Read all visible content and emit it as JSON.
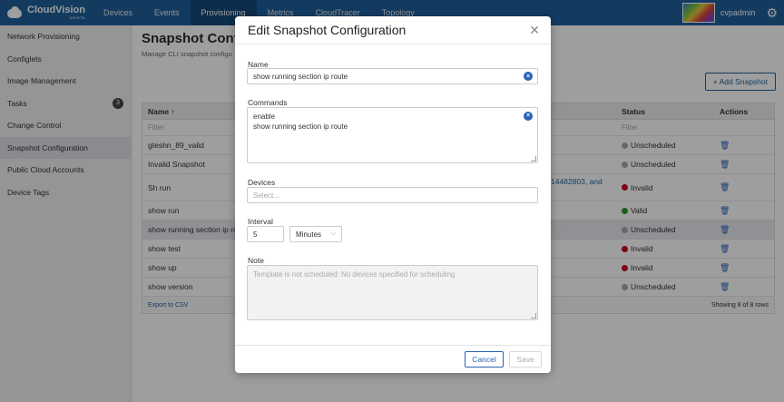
{
  "brand": {
    "name": "CloudVision",
    "sub": "ARISTA"
  },
  "nav": {
    "tabs": [
      "Devices",
      "Events",
      "Provisioning",
      "Metrics",
      "CloudTracer",
      "Topology"
    ],
    "active": "Provisioning"
  },
  "user": {
    "name": "cvpadmin"
  },
  "sidebar": {
    "items": [
      {
        "label": "Network Provisioning"
      },
      {
        "label": "Configlets"
      },
      {
        "label": "Image Management"
      },
      {
        "label": "Tasks",
        "badge": "3"
      },
      {
        "label": "Change Control"
      },
      {
        "label": "Snapshot Configuration",
        "active": true
      },
      {
        "label": "Public Cloud Accounts"
      },
      {
        "label": "Device Tags"
      }
    ]
  },
  "page": {
    "title": "Snapshot Configu",
    "subtitle": "Manage CLI snapshot configu",
    "add_button": "+ Add Snapshot"
  },
  "table": {
    "headers": {
      "name": "Name ↑",
      "status": "Status",
      "actions": "Actions"
    },
    "filter_placeholder": {
      "name": "Filter",
      "status": "Filter"
    },
    "rows": [
      {
        "name": "gteshn_89_valid",
        "status": "Unscheduled",
        "status_color": "#a8a8a8"
      },
      {
        "name": "Invalid Snapshot",
        "status": "Unscheduled",
        "status_color": "#a8a8a8"
      },
      {
        "name": "Sh run",
        "mid": "14482803, and",
        "status": "Invalid",
        "status_color": "#d0021b"
      },
      {
        "name": "show run",
        "status": "Valid",
        "status_color": "#2a9d2a"
      },
      {
        "name": "show running section ip ro",
        "status": "Unscheduled",
        "status_color": "#a8a8a8"
      },
      {
        "name": "show test",
        "status": "Invalid",
        "status_color": "#d0021b"
      },
      {
        "name": "show up",
        "status": "Invalid",
        "status_color": "#d0021b"
      },
      {
        "name": "show version",
        "status": "Unscheduled",
        "status_color": "#a8a8a8"
      }
    ],
    "export": "Export to CSV",
    "showing": "Showing 8 of 8 rows"
  },
  "modal": {
    "title": "Edit Snapshot Configuration",
    "name_label": "Name",
    "name_value": "show running section ip route",
    "commands_label": "Commands",
    "commands_line1": "enable",
    "commands_line2": "show running section ip route",
    "devices_label": "Devices",
    "devices_placeholder": "Select...",
    "interval_label": "Interval",
    "interval_value": "5",
    "interval_unit": "Minutes",
    "note_label": "Note",
    "note_placeholder": "Template is not scheduled: No devices specified for scheduling",
    "cancel": "Cancel",
    "save": "Save"
  }
}
